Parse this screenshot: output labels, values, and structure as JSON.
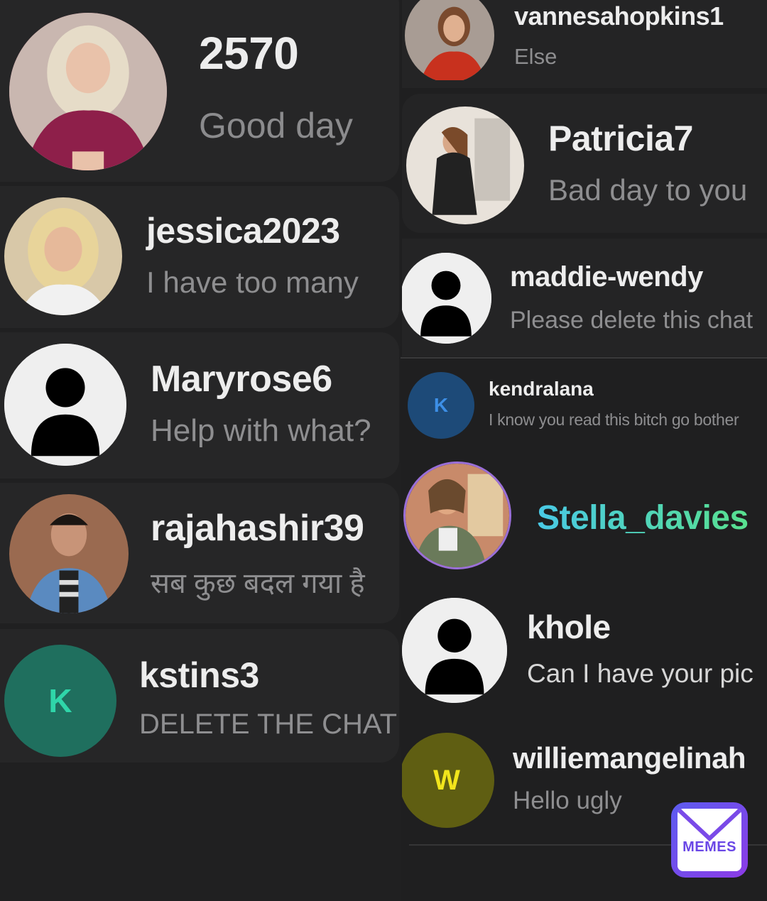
{
  "left_column": [
    {
      "name": "2570",
      "message": "Good day",
      "avatar": "photo-blonde-woman-icon"
    },
    {
      "name": "jessica2023",
      "message": "I have too many",
      "avatar": "photo-blonde-woman-icon"
    },
    {
      "name": "Maryrose6",
      "message": "Help with what?",
      "avatar": "default-user-icon"
    },
    {
      "name": "rajahashir39",
      "message": "सब कुछ बदल गया है",
      "avatar": "photo-man-icon"
    },
    {
      "name": "kstins3",
      "message": "DELETE THE CHAT",
      "avatar_letter": "K",
      "avatar_color": "#1f6f5e",
      "letter_color": "#2fd6a9"
    }
  ],
  "right_column": [
    {
      "name": "vannesahopkins1",
      "message": "Else",
      "avatar": "photo-woman-red-icon"
    },
    {
      "name": "Patricia7",
      "message": "Bad day to you",
      "avatar": "photo-woman-dress-icon"
    },
    {
      "name": "maddie-wendy",
      "message": "Please delete this chat",
      "avatar": "default-user-icon"
    },
    {
      "name": "kendralana",
      "message": "I know you read this bitch go bother",
      "avatar_letter": "K",
      "avatar_color": "#1d4a78",
      "letter_color": "#3d8fe6"
    },
    {
      "name": "Stella_davies",
      "message": "",
      "avatar": "photo-woman-green-icon",
      "name_gradient": [
        "#49c9e6",
        "#58e08e"
      ]
    },
    {
      "name": "khole",
      "message": "Can I have your pic",
      "avatar": "default-user-icon"
    },
    {
      "name": "williemangelinah",
      "message": "Hello ugly",
      "avatar_letter": "W",
      "avatar_color": "#5f5e12",
      "letter_color": "#f2e51c"
    }
  ],
  "watermark": {
    "label": "MEMES",
    "icon": "memes-envelope-icon",
    "colors": [
      "#5c5cf0",
      "#8c3be6"
    ]
  }
}
